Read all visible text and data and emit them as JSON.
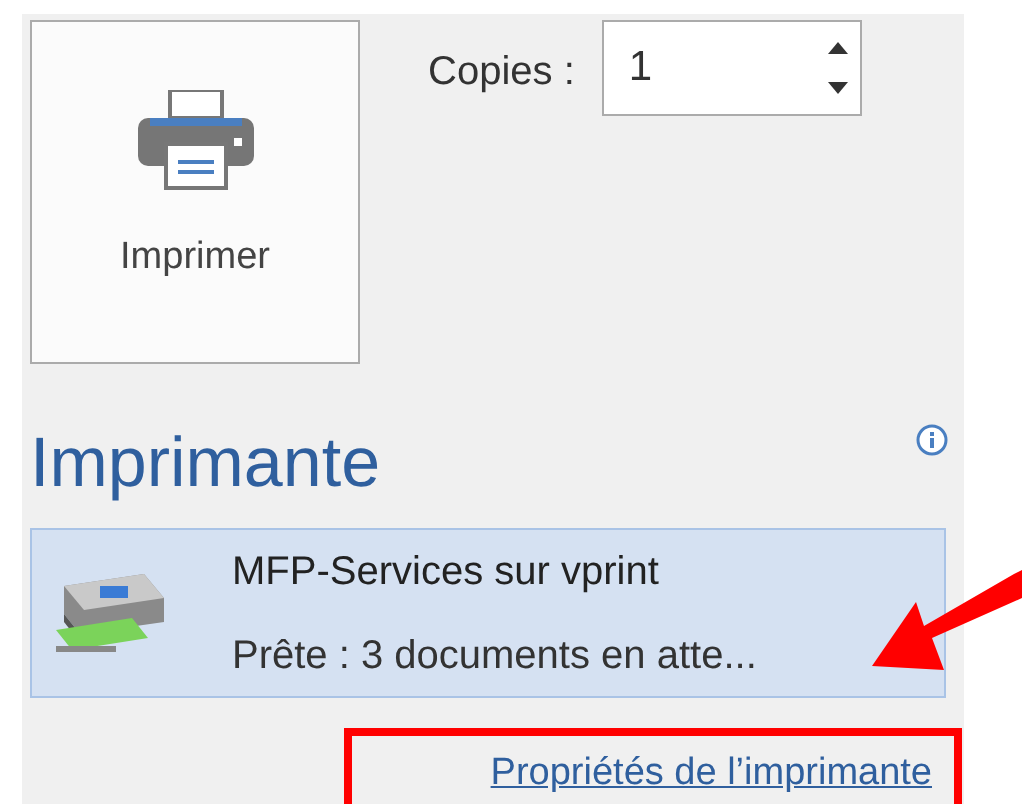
{
  "print_button": {
    "label": "Imprimer"
  },
  "copies": {
    "label": "Copies :",
    "value": "1"
  },
  "printer_section": {
    "heading": "Imprimante",
    "printer": {
      "name": "MFP-Services sur vprint",
      "status": "Prête : 3 documents en atte...",
      "selected": true
    },
    "properties_link": "Propriétés de l’imprimante"
  }
}
